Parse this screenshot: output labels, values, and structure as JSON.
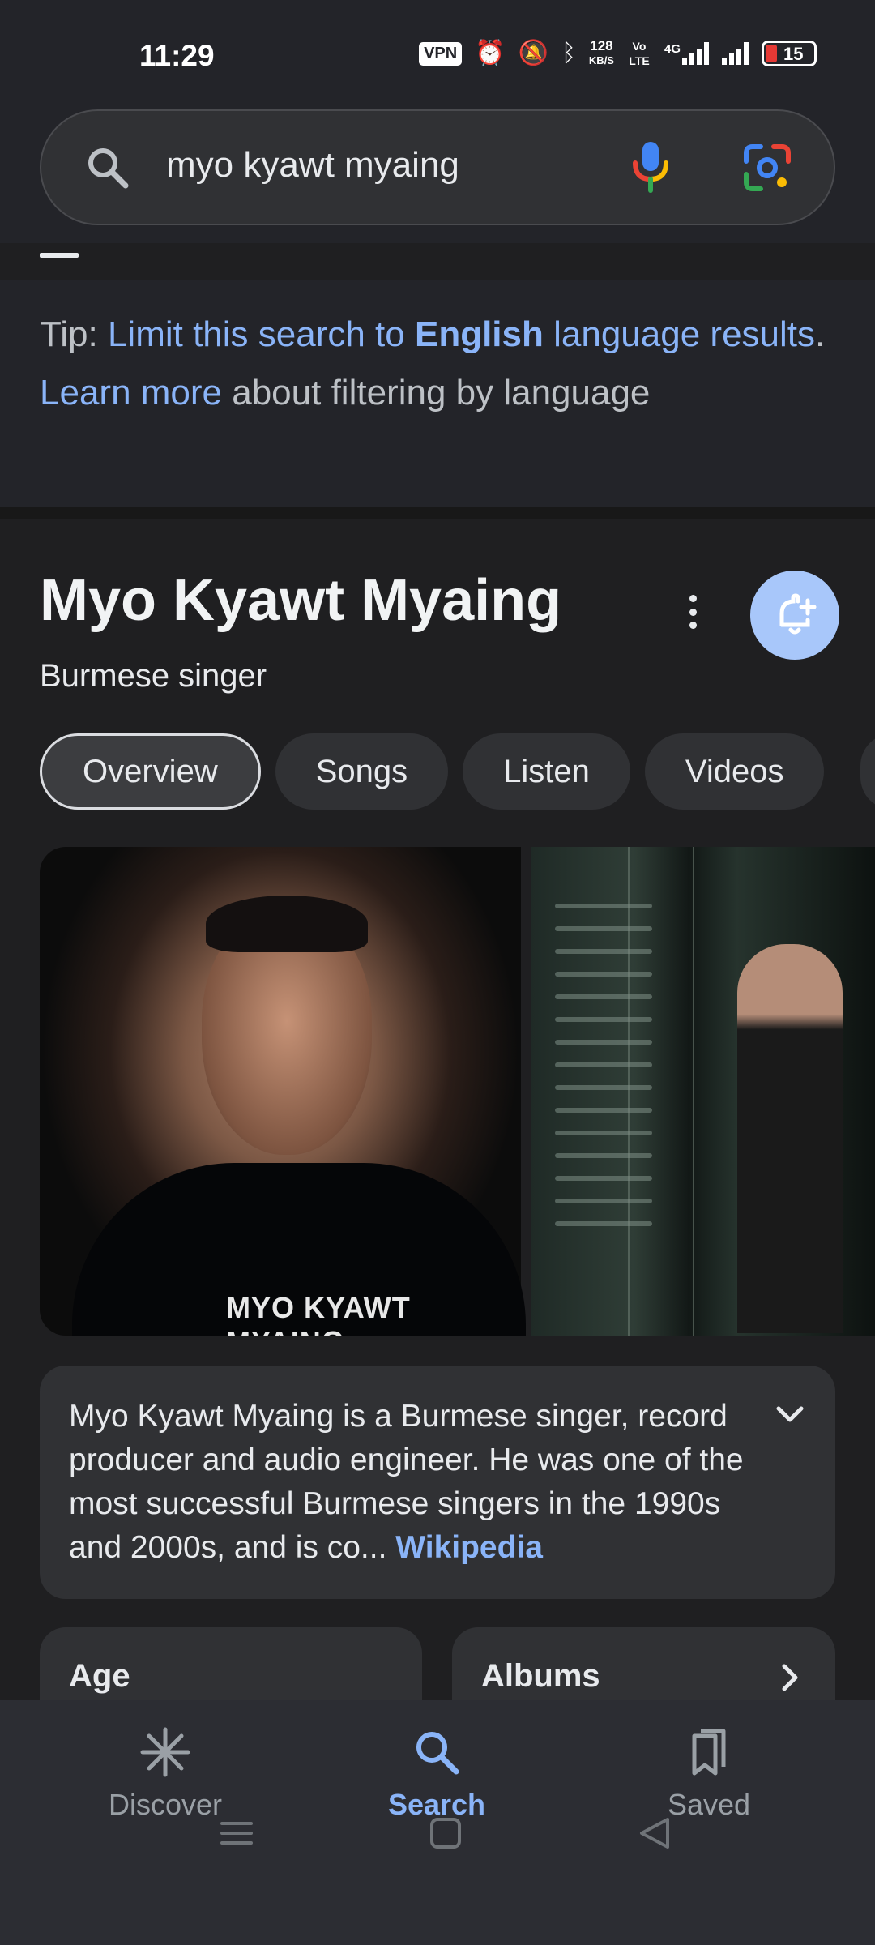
{
  "status_bar": {
    "time": "11:29",
    "vpn": "VPN",
    "net_speed_value": "128",
    "net_speed_unit": "KB/S",
    "volte": "Vo LTE",
    "network": "4G",
    "battery": "15"
  },
  "search": {
    "query": "myo kyawt myaing"
  },
  "tip": {
    "prefix": "Tip: ",
    "link1_a": "Limit this search to ",
    "link1_bold": "English",
    "link1_b": " language results",
    "period": ". ",
    "link2": "Learn more",
    "suffix": " about filtering by language"
  },
  "knowledge_panel": {
    "title": "Myo Kyawt Myaing",
    "subtitle": "Burmese singer",
    "chips": [
      {
        "label": "Overview"
      },
      {
        "label": "Songs"
      },
      {
        "label": "Listen"
      },
      {
        "label": "Videos"
      }
    ],
    "photo_caption": "MYO KYAWT MYAING",
    "description": "Myo Kyawt Myaing is a Burmese singer, record producer and audio engineer. He was one of the most successful Burmese singers in the 1990s and 2000s, and is co...",
    "source": "Wikipedia",
    "cards": {
      "age": "Age",
      "albums": "Albums"
    }
  },
  "bottom_nav": {
    "discover": "Discover",
    "search": "Search",
    "saved": "Saved"
  },
  "colors": {
    "accent": "#8ab4f8",
    "bell_button": "#a8c7fa",
    "background": "#1f1f21"
  }
}
